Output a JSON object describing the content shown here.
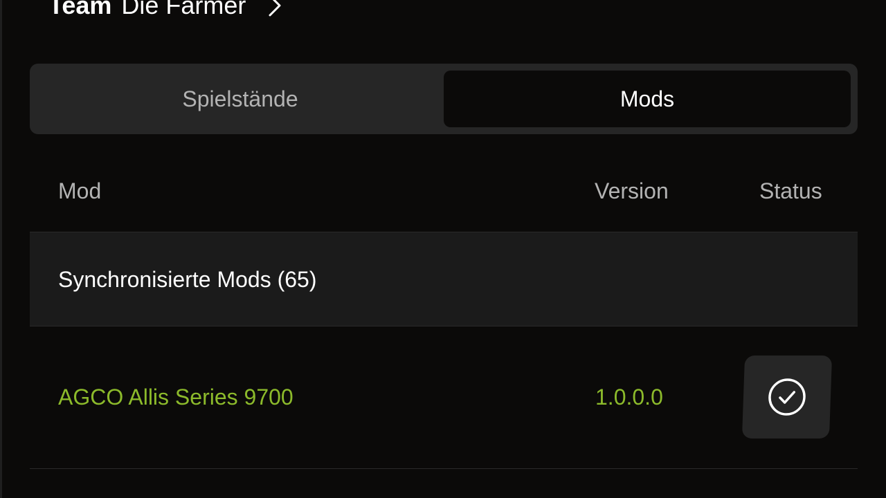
{
  "header": {
    "team_label": "Team",
    "team_name": "Die Farmer",
    "chevron_icon": "chevron-right-icon"
  },
  "tabs": [
    {
      "label": "Spielstände",
      "active": false
    },
    {
      "label": "Mods",
      "active": true
    }
  ],
  "table": {
    "columns": [
      "Mod",
      "Version",
      "Status"
    ],
    "group": {
      "label": "Synchronisierte Mods (65)"
    },
    "rows": [
      {
        "name": "AGCO Allis Series 9700",
        "version": "1.0.0.0",
        "status_icon": "check-circle-icon"
      }
    ]
  },
  "colors": {
    "background": "#0b0a09",
    "panel": "#262626",
    "accent_green": "#8cba2b",
    "muted_text": "#b3b3b3",
    "text": "#ffffff"
  }
}
